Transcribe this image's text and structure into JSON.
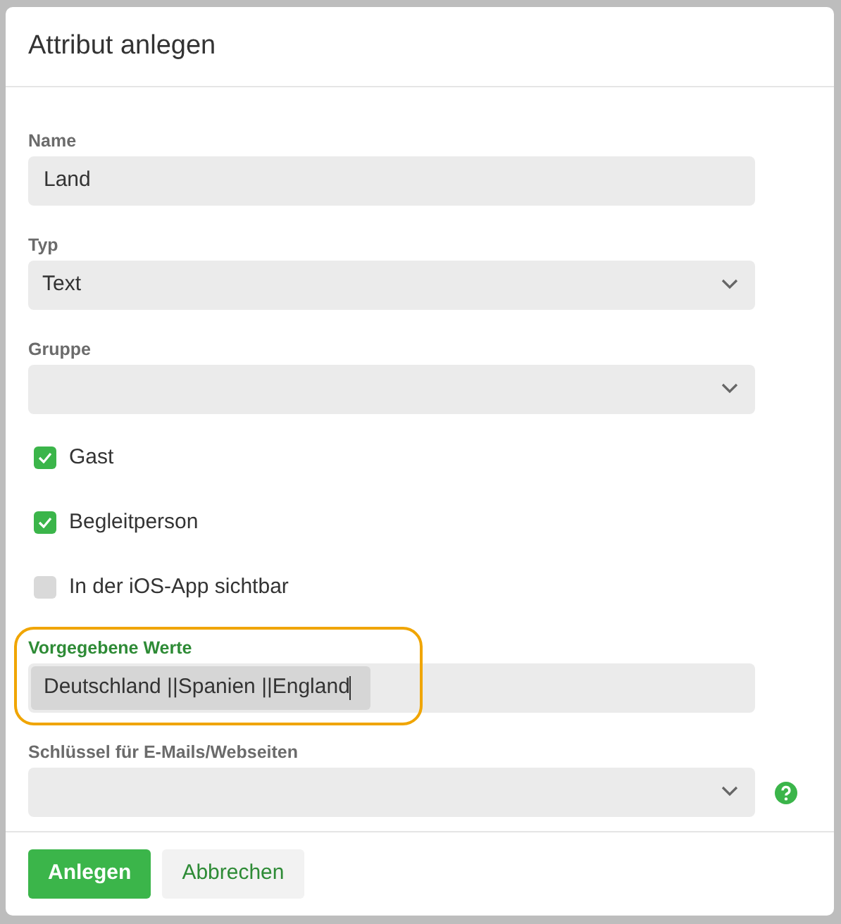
{
  "dialog": {
    "title": "Attribut anlegen",
    "fields": [
      {
        "kind": "text",
        "label": "Name",
        "value": "Land"
      },
      {
        "kind": "select",
        "label": "Typ",
        "value": "Text"
      },
      {
        "kind": "select",
        "label": "Gruppe"
      },
      {
        "kind": "checkbox",
        "label": "Gast",
        "checked": true
      },
      {
        "kind": "checkbox",
        "label": "Begleitperson",
        "checked": true
      },
      {
        "kind": "checkbox",
        "label": "In der iOS-App sichtbar",
        "checked": false
      },
      {
        "kind": "text",
        "label": "Vorgegebene Werte",
        "value": "Deutschland ||Spanien ||England",
        "focused": true,
        "text_selected": true,
        "annotated": true
      },
      {
        "kind": "select",
        "label": "Schlüssel für E-Mails/Webseiten",
        "help_icon": true
      }
    ],
    "buttons": [
      {
        "label": "Anlegen",
        "primary": true
      },
      {
        "label": "Abbrechen",
        "primary": false
      }
    ]
  }
}
